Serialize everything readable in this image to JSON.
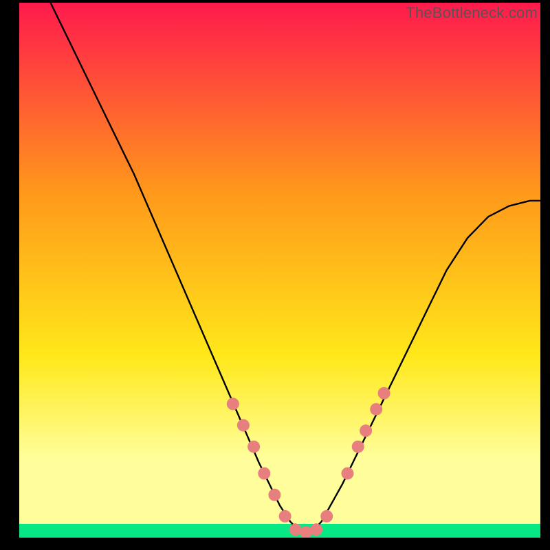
{
  "watermark": "TheBottleneck.com",
  "chart_data": {
    "type": "line",
    "title": "",
    "xlabel": "",
    "ylabel": "",
    "xlim": [
      0,
      100
    ],
    "ylim": [
      0,
      100
    ],
    "grid": false,
    "legend": false,
    "background_gradient": {
      "top": "#ff1a4d",
      "mid1": "#ff9a1a",
      "mid2": "#ffe81a",
      "low": "#fffe9a",
      "bottom_band": "#06e884"
    },
    "series": [
      {
        "name": "curve",
        "color": "#000000",
        "x": [
          6,
          10,
          14,
          18,
          22,
          26,
          30,
          34,
          38,
          42,
          46,
          50,
          52,
          54,
          56,
          58,
          62,
          66,
          70,
          74,
          78,
          82,
          86,
          90,
          94,
          98,
          100
        ],
        "y": [
          100,
          92,
          84,
          76,
          68,
          59,
          50,
          41,
          32,
          23,
          14,
          6,
          3,
          1,
          1,
          3,
          10,
          18,
          26,
          34,
          42,
          50,
          56,
          60,
          62,
          63,
          63
        ]
      }
    ],
    "markers": {
      "name": "highlight-dots",
      "color": "#e77f7f",
      "points": [
        {
          "x": 41,
          "y": 25
        },
        {
          "x": 43,
          "y": 21
        },
        {
          "x": 45,
          "y": 17
        },
        {
          "x": 47,
          "y": 12
        },
        {
          "x": 49,
          "y": 8
        },
        {
          "x": 51,
          "y": 4
        },
        {
          "x": 53,
          "y": 1.5
        },
        {
          "x": 55,
          "y": 1
        },
        {
          "x": 57,
          "y": 1.5
        },
        {
          "x": 59,
          "y": 4
        },
        {
          "x": 63,
          "y": 12
        },
        {
          "x": 65,
          "y": 17
        },
        {
          "x": 66.5,
          "y": 20
        },
        {
          "x": 68.5,
          "y": 24
        },
        {
          "x": 70,
          "y": 27
        }
      ]
    }
  }
}
